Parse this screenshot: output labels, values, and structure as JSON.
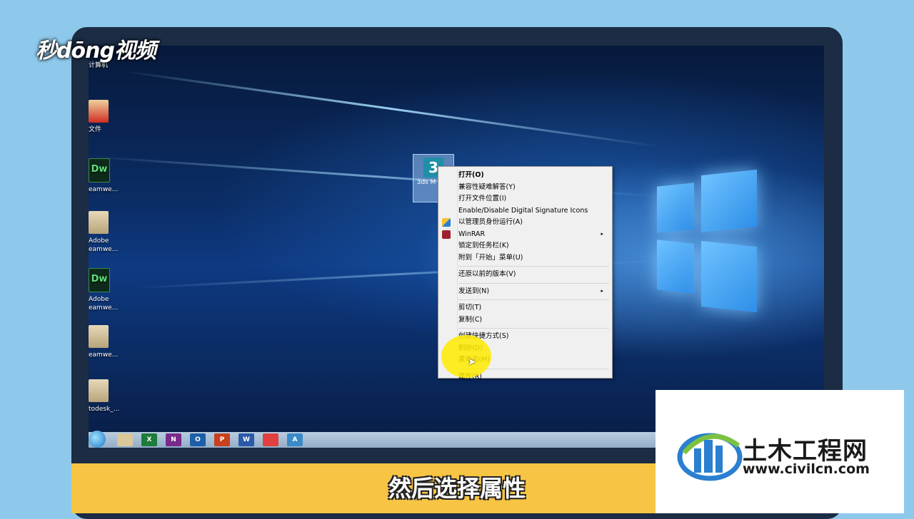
{
  "brand": {
    "name": "秒dōng视频"
  },
  "desktop": {
    "icons": [
      {
        "label": "计算机",
        "type": "computer"
      },
      {
        "label": "文件",
        "type": "red"
      },
      {
        "label": "eamwe...",
        "type": "dw",
        "glyph": "Dw"
      },
      {
        "label": "Adobe eamwe...",
        "type": "folder"
      },
      {
        "label": "Adobe eamwe...",
        "type": "dw",
        "glyph": "Dw"
      },
      {
        "label": "eamwe...",
        "type": "folder"
      },
      {
        "label": "todesk_...",
        "type": "folder"
      }
    ],
    "selected_icon": {
      "glyph": "3",
      "label": "3ds M 201"
    }
  },
  "context_menu": {
    "items": [
      {
        "label": "打开(O)",
        "bold": true
      },
      {
        "label": "兼容性疑难解答(Y)"
      },
      {
        "label": "打开文件位置(I)"
      },
      {
        "label": "Enable/Disable Digital Signature Icons"
      },
      {
        "label": "以管理员身份运行(A)",
        "icon": "shield-icon"
      },
      {
        "label": "WinRAR",
        "icon": "winrar-icon",
        "submenu": true
      },
      {
        "label": "锁定到任务栏(K)"
      },
      {
        "label": "附到「开始」菜单(U)"
      },
      {
        "separator": true
      },
      {
        "label": "还原以前的版本(V)"
      },
      {
        "separator": true
      },
      {
        "label": "发送到(N)",
        "submenu": true
      },
      {
        "separator": true
      },
      {
        "label": "剪切(T)"
      },
      {
        "label": "复制(C)"
      },
      {
        "separator": true
      },
      {
        "label": "创建快捷方式(S)"
      },
      {
        "label": "删除(D)"
      },
      {
        "label": "重命名(M)"
      },
      {
        "separator": true
      },
      {
        "label": "属性(R)"
      }
    ],
    "submenu_arrow": "▸"
  },
  "taskbar": {
    "items": [
      {
        "glyph": "",
        "color": "#d8c89a"
      },
      {
        "glyph": "X",
        "color": "#1e7b3c"
      },
      {
        "glyph": "N",
        "color": "#7a2a8a"
      },
      {
        "glyph": "O",
        "color": "#1a5fa8"
      },
      {
        "glyph": "P",
        "color": "#c8401e"
      },
      {
        "glyph": "W",
        "color": "#2a5aa8"
      },
      {
        "glyph": "",
        "color": "#e04040"
      },
      {
        "glyph": "A",
        "color": "#3a8ac8"
      }
    ]
  },
  "caption": {
    "text": "然后选择属性"
  },
  "civil": {
    "title": "土木工程网",
    "url": "www.civilcn.com"
  },
  "colors": {
    "caption_bar": "#f7c443",
    "frame": "#1b2c44",
    "accent_blue": "#2e8ee8"
  }
}
